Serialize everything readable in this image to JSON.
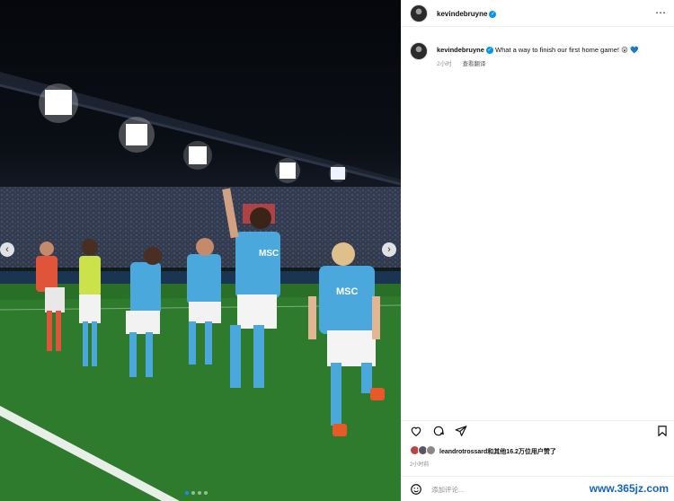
{
  "post": {
    "username": "kevindebruyne",
    "verified_mark": "✓",
    "more_icon": "⋯",
    "caption_text": "What a way to finish our first home game! 😮 💙",
    "time_ago": "2小时",
    "translate_label": "查看翻译"
  },
  "photo": {
    "prev_arrow": "‹",
    "next_arrow": "›",
    "slide_count": 4,
    "active_slide": 1,
    "sponsor_text": "MSC"
  },
  "actions": {
    "icons": [
      "heart-icon",
      "comment-icon",
      "share-icon",
      "bookmark-icon"
    ]
  },
  "likes": {
    "liker": "leandrotrossard",
    "rest_text": "和其他16.2万位用户赞了"
  },
  "time_detail": "2小时前",
  "comment": {
    "placeholder": "添加评论..."
  },
  "watermark": "www.365jz.com",
  "colors": {
    "accent_blue": "#0095f6",
    "napoli_blue": "#4aa8dc",
    "pitch_green": "#2e7a2c"
  }
}
